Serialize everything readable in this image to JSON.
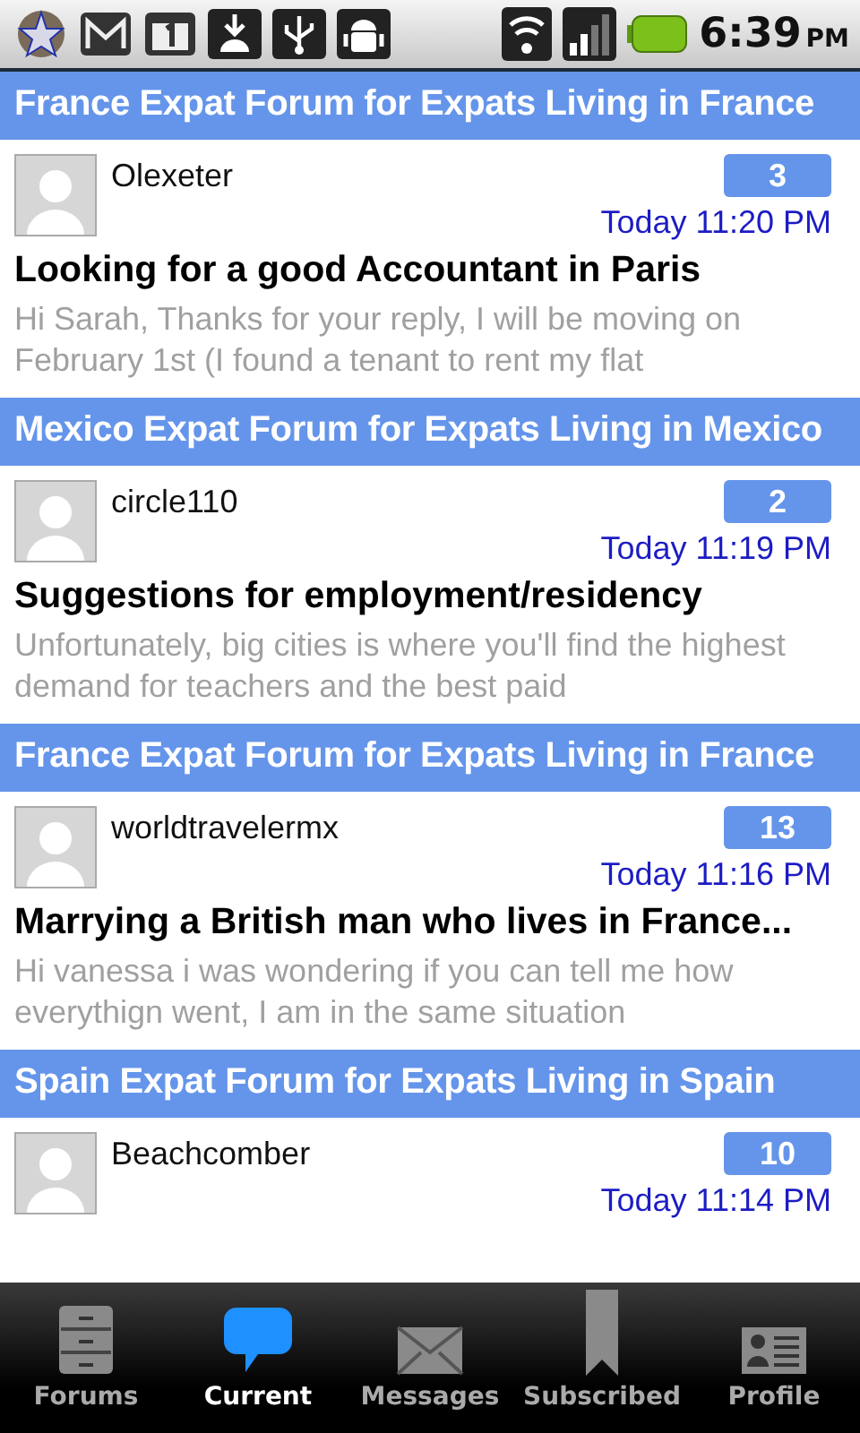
{
  "status_bar": {
    "time": "6:39",
    "meridiem": "PM"
  },
  "threads": [
    {
      "forum": "France Expat Forum for Expats Living in France",
      "user": "Olexeter",
      "replies": "3",
      "time": "Today 11:20 PM",
      "title": "Looking for a good Accountant in Paris",
      "preview": "Hi Sarah,  Thanks for your reply, I will be moving on February 1st (I found a tenant to rent my flat"
    },
    {
      "forum": "Mexico Expat Forum for Expats Living in Mexico",
      "user": "circle110",
      "replies": "2",
      "time": "Today 11:19 PM",
      "title": "Suggestions for employment/residency",
      "preview": "Unfortunately, big cities is where you'll find the highest demand for teachers and the best paid"
    },
    {
      "forum": "France Expat Forum for Expats Living in France",
      "user": "worldtravelermx",
      "replies": "13",
      "time": "Today 11:16 PM",
      "title": "Marrying a British man who lives in France...",
      "preview": "Hi vanessa i was wondering if you can tell me how everythign went, I am in the same situation"
    },
    {
      "forum": "Spain Expat Forum for Expats Living in Spain",
      "user": "Beachcomber",
      "replies": "10",
      "time": "Today 11:14 PM"
    }
  ],
  "nav": [
    {
      "kind": "forums",
      "label": "Forums",
      "selected": false
    },
    {
      "kind": "current",
      "label": "Current",
      "selected": true
    },
    {
      "kind": "messages",
      "label": "Messages",
      "selected": false
    },
    {
      "kind": "subscribed",
      "label": "Subscribed",
      "selected": false
    },
    {
      "kind": "profile",
      "label": "Profile",
      "selected": false
    }
  ]
}
